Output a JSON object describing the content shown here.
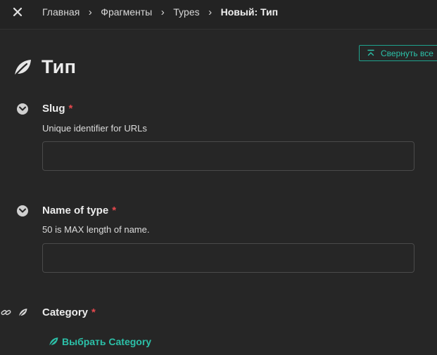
{
  "breadcrumbs": {
    "items": [
      "Главная",
      "Фрагменты",
      "Types"
    ],
    "current": "Новый: Тип",
    "separator": "›"
  },
  "edge_glyph": "(",
  "toolbar": {
    "collapse_label": "Свернуть все"
  },
  "page": {
    "title": "Тип"
  },
  "fields": {
    "slug": {
      "label": "Slug",
      "required_mark": "*",
      "hint": "Unique identifier for URLs",
      "value": ""
    },
    "name": {
      "label": "Name of type",
      "required_mark": "*",
      "hint": "50 is MAX length of name.",
      "value": ""
    },
    "category": {
      "label": "Category",
      "required_mark": "*",
      "choose_label": "Выбрать Category"
    }
  },
  "colors": {
    "background": "#262626",
    "accent": "#2cc0a8",
    "required": "#e5484d"
  }
}
